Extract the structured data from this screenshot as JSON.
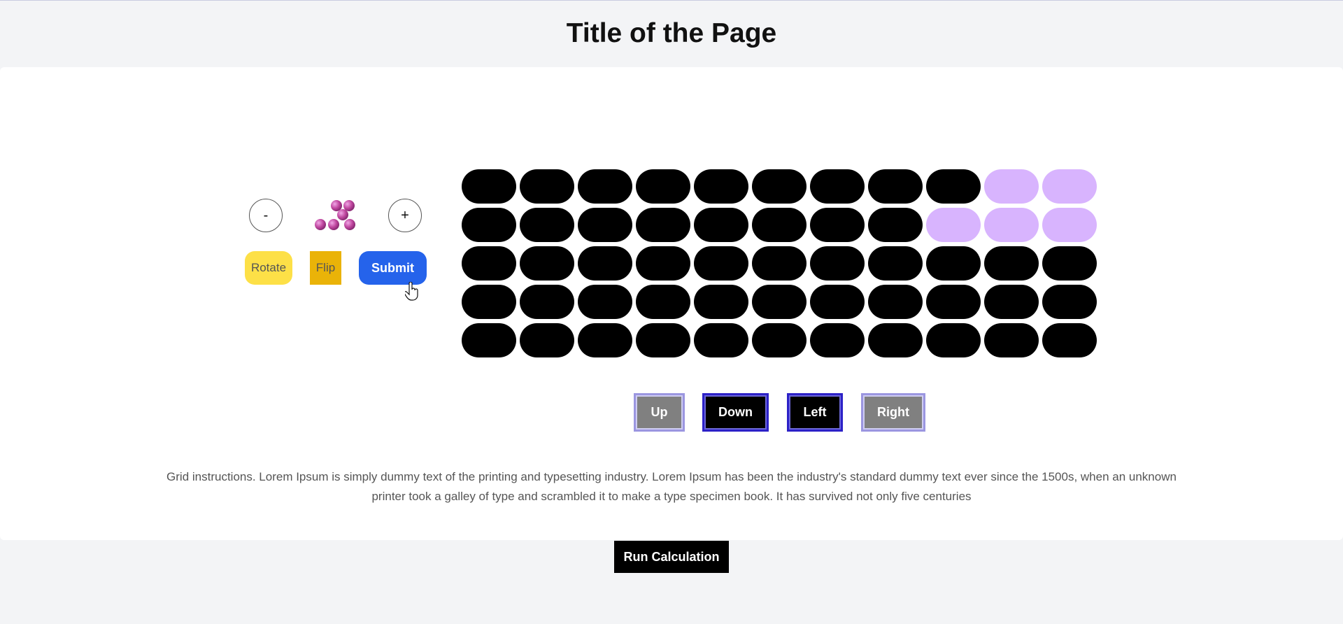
{
  "page": {
    "title": "Title of the Page"
  },
  "controls": {
    "minus_label": "-",
    "plus_label": "+",
    "piece_icon": "purple-molecule-piece-icon",
    "rotate_label": "Rotate",
    "flip_label": "Flip",
    "submit_label": "Submit"
  },
  "grid": {
    "rows": 5,
    "cols": 11,
    "colors": {
      "empty": "#000000",
      "filled": "#d8b4fe"
    },
    "filled_cells": [
      [
        0,
        9
      ],
      [
        0,
        10
      ],
      [
        1,
        8
      ],
      [
        1,
        9
      ],
      [
        1,
        10
      ]
    ]
  },
  "directions": {
    "up_label": "Up",
    "down_label": "Down",
    "left_label": "Left",
    "right_label": "Right"
  },
  "instructions": "Grid instructions. Lorem Ipsum is simply dummy text of the printing and typesetting industry. Lorem Ipsum has been the industry's standard dummy text ever since the 1500s, when an unknown printer took a galley of type and scrambled it to make a type specimen book. It has survived not only five centuries",
  "run_label": "Run Calculation"
}
